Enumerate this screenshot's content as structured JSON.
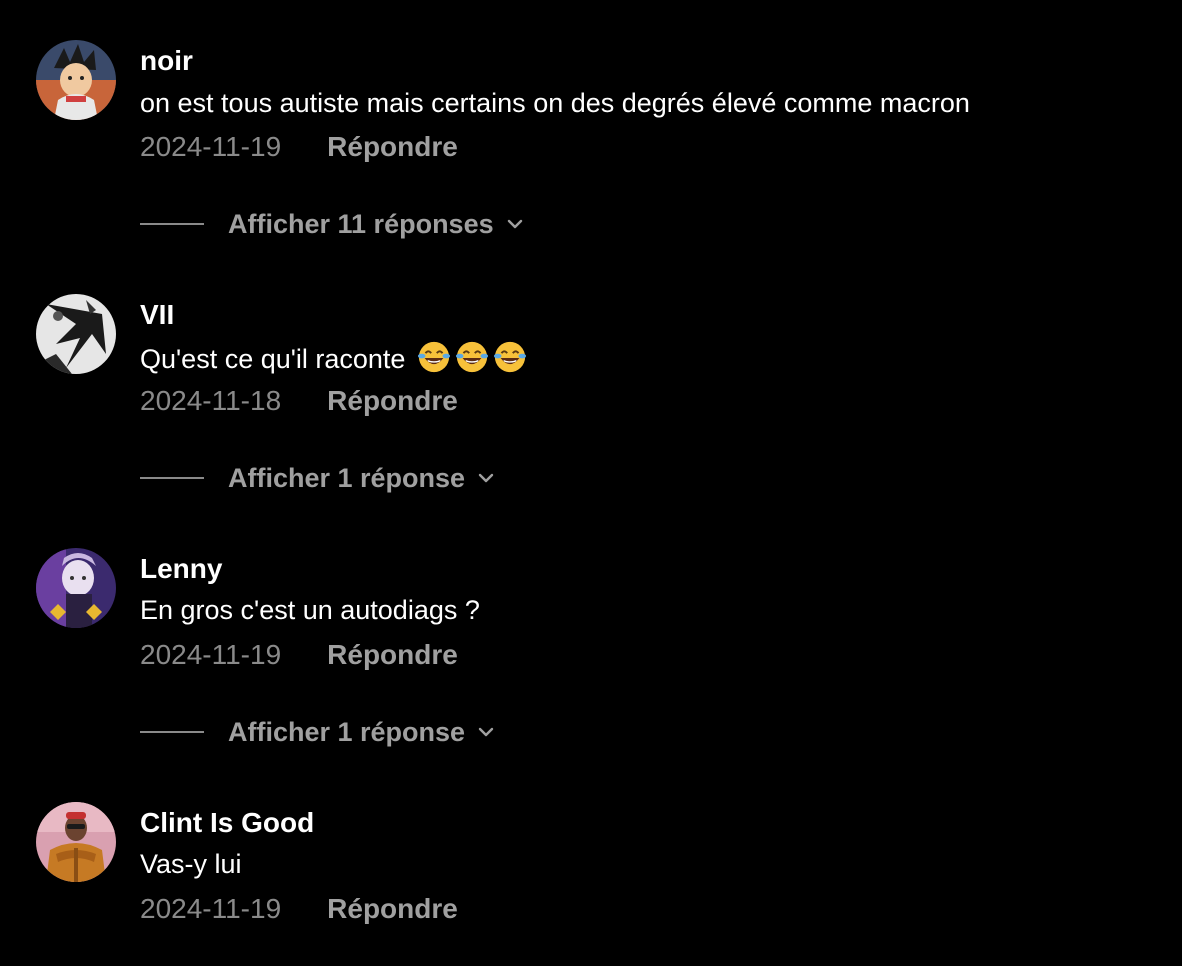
{
  "comments": [
    {
      "username": "noir",
      "text": "on est tous autiste mais certains on des degrés élevé comme macron",
      "date": "2024-11-19",
      "reply_label": "Répondre",
      "show_replies": "Afficher 11 réponses",
      "avatar_icon": "anime-character-avatar"
    },
    {
      "username": "VII",
      "text": "Qu'est ce qu'il raconte",
      "emojis": [
        "face-with-tears-of-joy",
        "face-with-tears-of-joy",
        "face-with-tears-of-joy"
      ],
      "date": "2024-11-18",
      "reply_label": "Répondre",
      "show_replies": "Afficher 1 réponse",
      "avatar_icon": "monochrome-manga-avatar"
    },
    {
      "username": "Lenny",
      "text": "En gros c'est un autodiags ?",
      "date": "2024-11-19",
      "reply_label": "Répondre",
      "show_replies": "Afficher 1 réponse",
      "avatar_icon": "purple-anime-avatar"
    },
    {
      "username": "Clint Is Good",
      "text": "Vas-y lui",
      "date": "2024-11-19",
      "reply_label": "Répondre",
      "avatar_icon": "person-orange-jacket-avatar"
    }
  ],
  "colors": {
    "background": "#000000",
    "primary_text": "#ffffff",
    "secondary_text": "#8a8a8a",
    "action_text": "#a0a0a0"
  }
}
